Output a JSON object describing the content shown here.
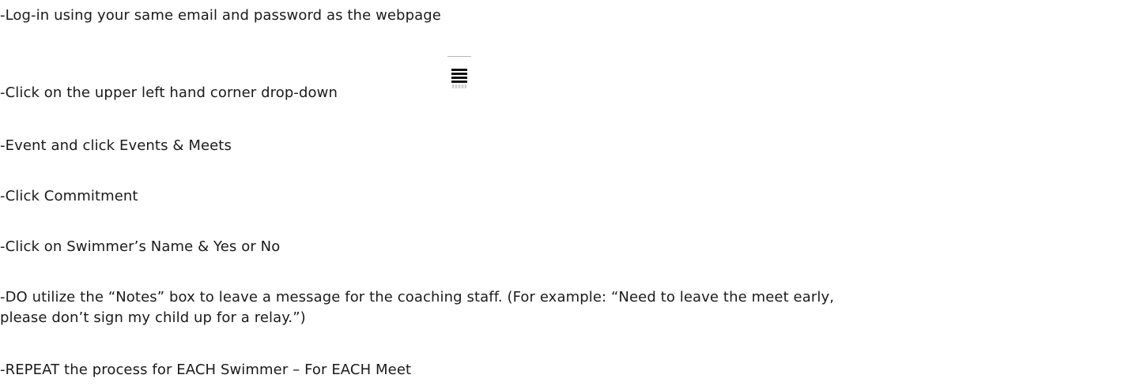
{
  "instructions": [
    "-Log-in using your same email and password as the webpage",
    "-Click on the upper left hand corner drop-down",
    "-Event  and click Events & Meets",
    "-Click Commitment",
    "-Click on Swimmer’s Name & Yes or No",
    "-DO utilize the “Notes” box to leave a message for the coaching staff.  (For example:  “Need to leave the meet early,",
    "please don’t sign my child up for a relay.”)",
    "-REPEAT the process for EACH Swimmer – For EACH Meet"
  ],
  "icons": {
    "dropdown": "hamburger-menu-icon"
  }
}
